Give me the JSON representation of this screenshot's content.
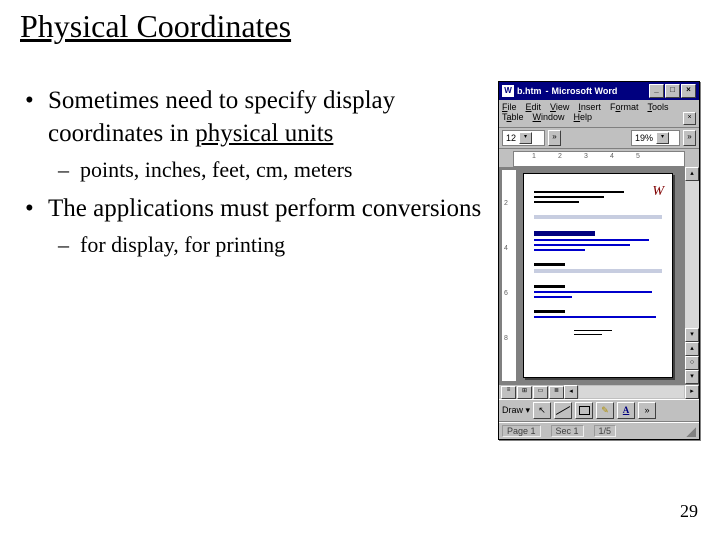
{
  "slide": {
    "title": "Physical Coordinates",
    "bullet1": "Sometimes need to specify display coordinates in ",
    "bullet1_underlined": "physical units",
    "bullet1_sub": "points, inches, feet, cm, meters",
    "bullet2": "The applications must perform conversions",
    "bullet2_sub": "for display, for printing",
    "page_number": "29"
  },
  "wordapp": {
    "doc_name": "b.htm",
    "app_name": "Microsoft Word",
    "menus": {
      "file": "File",
      "edit": "Edit",
      "view": "View",
      "insert": "Insert",
      "format": "Format",
      "tools": "Tools",
      "table": "Table",
      "window": "Window",
      "help": "Help"
    },
    "font_size": "12",
    "zoom": "19%",
    "ruler_marks": [
      "1",
      "2",
      "3",
      "4",
      "5"
    ],
    "ruler_v_marks": [
      "2",
      "4",
      "6",
      "8"
    ],
    "signature": "W",
    "draw_label": "Draw",
    "status": {
      "page": "Page 1",
      "sec": "Sec 1",
      "pos": "1/5"
    }
  }
}
